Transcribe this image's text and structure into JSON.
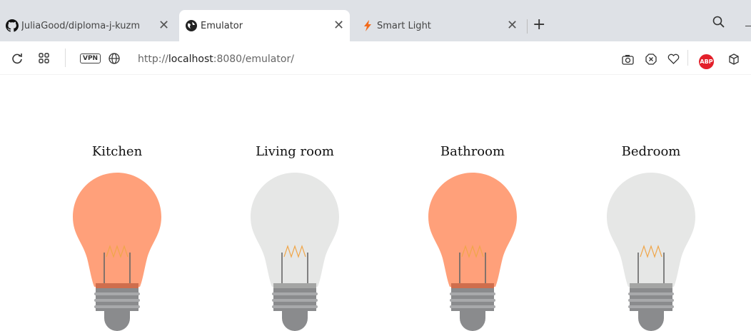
{
  "browser": {
    "tabs": [
      {
        "title": "JuliaGood/diploma-j-kuzm",
        "icon": "github-icon",
        "active": false
      },
      {
        "title": "Emulator",
        "icon": "globe-icon",
        "active": true
      },
      {
        "title": "Smart Light",
        "icon": "lightning-icon",
        "active": false
      }
    ],
    "new_tab_label": "+",
    "vpn_label": "VPN",
    "url_prefix": "http://",
    "url_host": "localhost",
    "url_rest": ":8080/emulator/",
    "abp_label": "ABP"
  },
  "rooms": [
    {
      "name": "Kitchen",
      "on": true
    },
    {
      "name": "Living room",
      "on": false
    },
    {
      "name": "Bathroom",
      "on": true
    },
    {
      "name": "Bedroom",
      "on": false
    }
  ],
  "colors": {
    "bulb_on": "#ffa07a",
    "bulb_off": "#e6e7e6",
    "base_on": "#cf6e4d",
    "base_off": "#a4a5a4",
    "screw": "#8a8b8d"
  }
}
